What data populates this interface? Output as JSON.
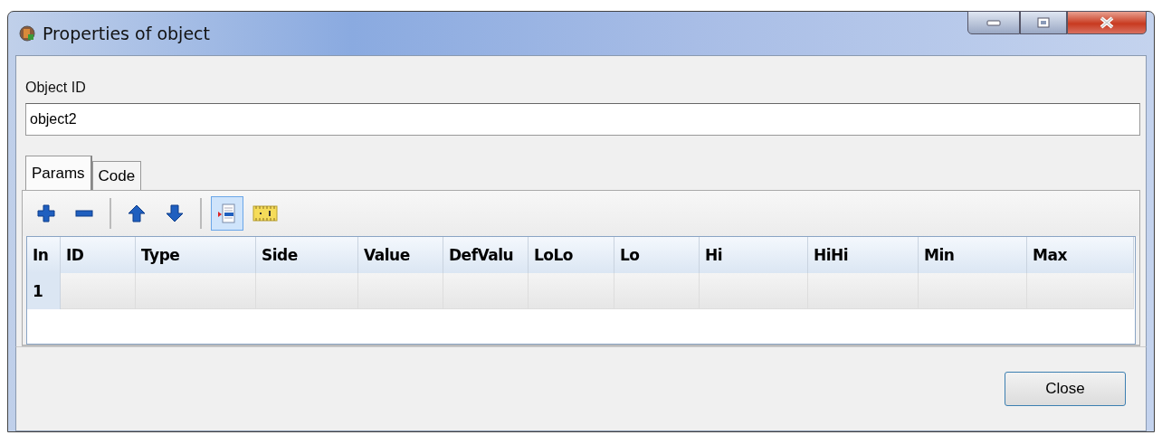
{
  "window": {
    "title": "Properties of object"
  },
  "object_id": {
    "label": "Object ID",
    "value": "object2"
  },
  "tabs": [
    {
      "label": "Params",
      "selected": true
    },
    {
      "label": "Code",
      "selected": false
    }
  ],
  "toolbar": [
    {
      "kind": "add",
      "on": false
    },
    {
      "kind": "remove",
      "on": false
    },
    {
      "kind": "separator"
    },
    {
      "kind": "up",
      "on": false
    },
    {
      "kind": "down",
      "on": false
    },
    {
      "kind": "separator"
    },
    {
      "kind": "list",
      "on": true
    },
    {
      "kind": "ruler",
      "on": false
    }
  ],
  "table": {
    "columns": [
      "In",
      "ID",
      "Type",
      "Side",
      "Value",
      "DefValu",
      "LoLo",
      "Lo",
      "Hi",
      "HiHi",
      "Min",
      "Max"
    ],
    "rows": [
      {
        "index": "1"
      }
    ]
  },
  "buttons": [
    "Close"
  ]
}
